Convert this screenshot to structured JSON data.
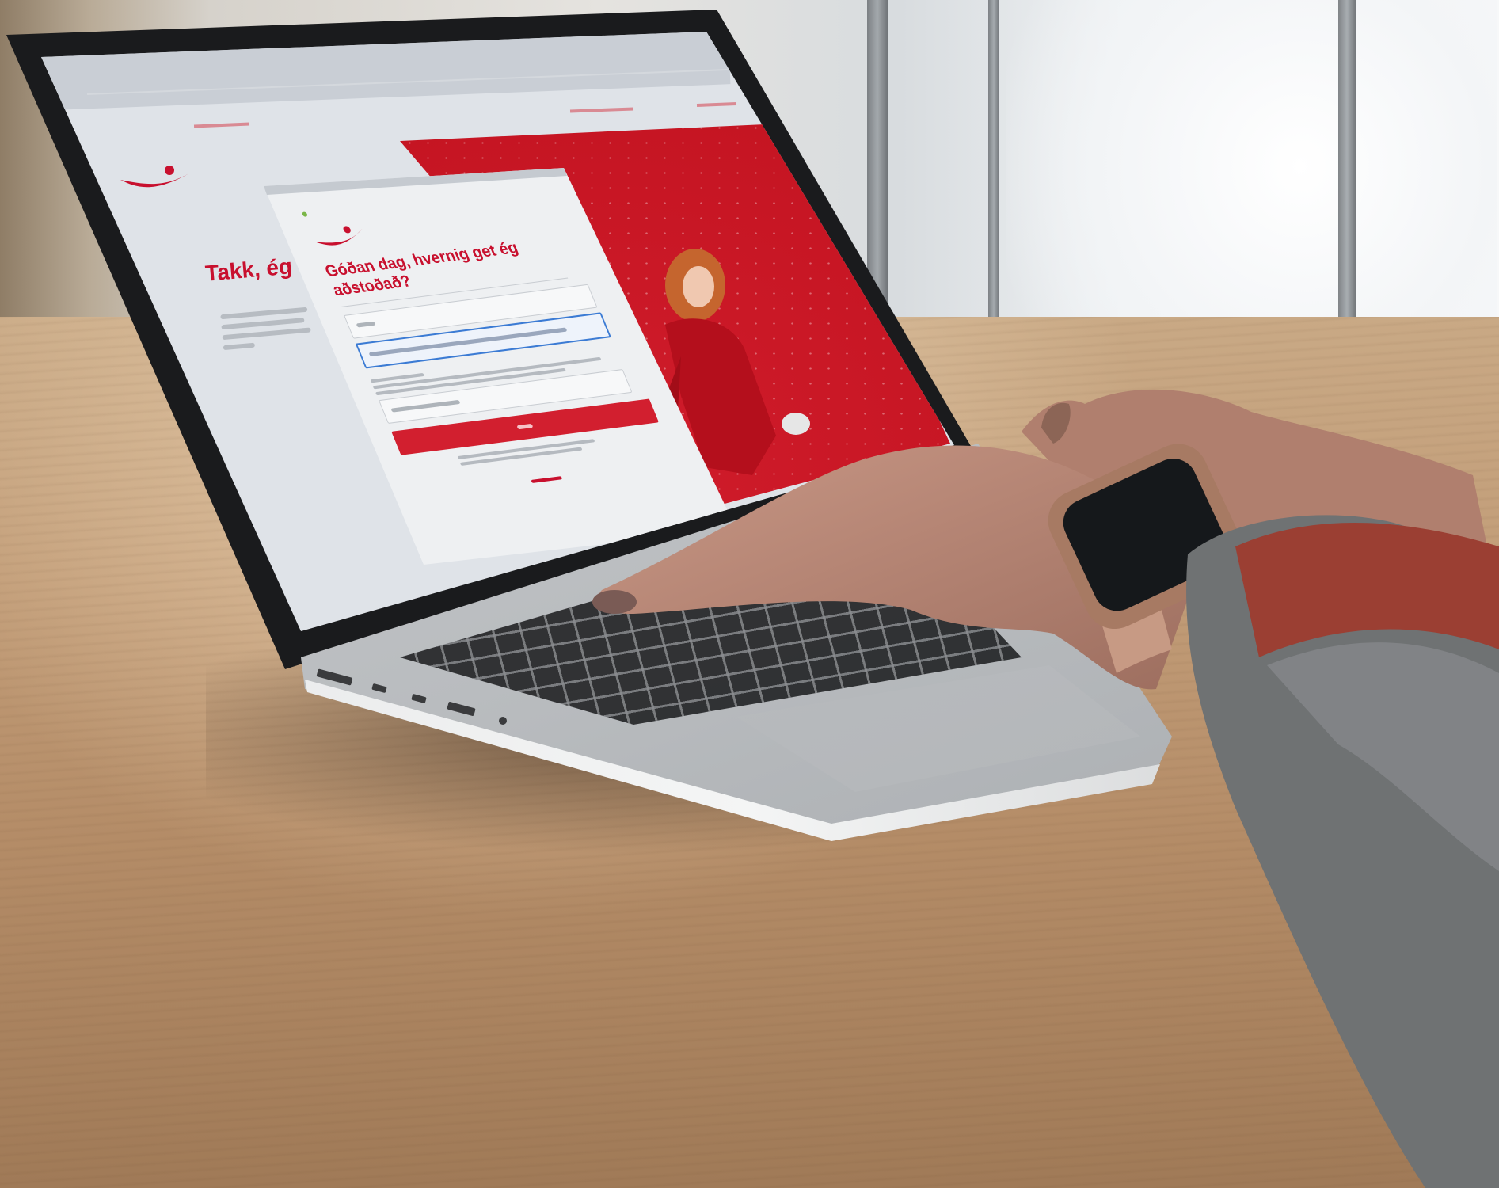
{
  "screen": {
    "page_title": "Takk, ég",
    "dialog": {
      "heading": "Góðan dag, hvernig get ég aðstoðað?"
    }
  },
  "colors": {
    "brand_red": "#c8102e",
    "hero_red": "#c1121f",
    "input_focus_blue": "#3b7bd4"
  }
}
